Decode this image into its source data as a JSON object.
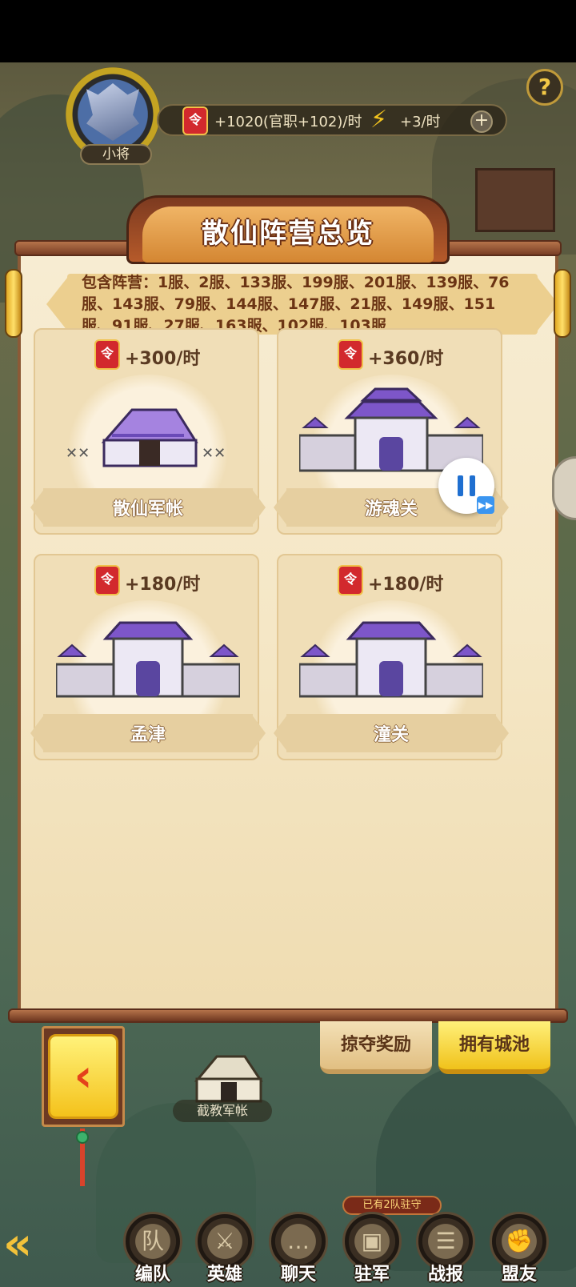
{
  "header": {
    "rank": "小将",
    "income": "+1020(官职+102)/时",
    "energy": "+3/时",
    "help_symbol": "?",
    "plus_symbol": "+"
  },
  "panel": {
    "title": "散仙阵营总览",
    "servers_text": "包含阵营：1服、2服、133服、199服、201服、139服、76服、143服、79服、144服、147服、21服、149服、151服、91服、27服、163服、102服、103服"
  },
  "cards": [
    {
      "rate": "+300/时",
      "name": "散仙军帐",
      "type": "tent"
    },
    {
      "rate": "+360/时",
      "name": "游魂关",
      "type": "fortress"
    },
    {
      "rate": "+180/时",
      "name": "孟津",
      "type": "fortress"
    },
    {
      "rate": "+180/时",
      "name": "潼关",
      "type": "fortress"
    }
  ],
  "tabs": {
    "loot": "掠夺奖励",
    "cities": "拥有城池"
  },
  "map": {
    "camp_label": "截教军帐",
    "garrison_tag": "已有2队驻守"
  },
  "nav": [
    {
      "label": "编队",
      "icon": "队"
    },
    {
      "label": "英雄",
      "icon": "⚔"
    },
    {
      "label": "聊天",
      "icon": "…"
    },
    {
      "label": "驻军",
      "icon": "▣"
    },
    {
      "label": "战报",
      "icon": "☰"
    },
    {
      "label": "盟友",
      "icon": "✊"
    }
  ],
  "colors": {
    "accent_gold": "#f4c21b",
    "paper": "#f5e7c6",
    "title_brown": "#6b3414",
    "castle_purple": "#7d56c9"
  }
}
